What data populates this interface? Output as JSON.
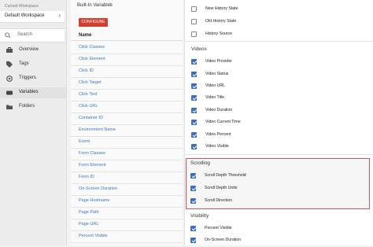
{
  "workspace": {
    "label": "Current Workspace",
    "name": "Default Workspace"
  },
  "search": {
    "placeholder": "Search"
  },
  "nav": [
    {
      "label": "Overview",
      "icon": "briefcase-icon"
    },
    {
      "label": "Tags",
      "icon": "tag-icon"
    },
    {
      "label": "Triggers",
      "icon": "trigger-icon"
    },
    {
      "label": "Variables",
      "icon": "variables-icon",
      "active": true
    },
    {
      "label": "Folders",
      "icon": "folder-icon"
    }
  ],
  "list": {
    "title": "Built-In Variables",
    "badge": "?",
    "configure_label": "CONFIGURE",
    "column_name": "Name",
    "items": [
      "Click Classes",
      "Click Element",
      "Click ID",
      "Click Target",
      "Click Text",
      "Click URL",
      "Container ID",
      "Environment Name",
      "Event",
      "Form Classes",
      "Form Element",
      "Form ID",
      "On-Screen Duration",
      "Page Hostname",
      "Page Path",
      "Page URL",
      "Percent Visible"
    ]
  },
  "panel": {
    "history": [
      {
        "label": "New History State",
        "checked": false
      },
      {
        "label": "Old History State",
        "checked": false
      },
      {
        "label": "History Source",
        "checked": false
      }
    ],
    "videos_title": "Videos",
    "videos": [
      {
        "label": "Video Provider",
        "checked": true
      },
      {
        "label": "Video Status",
        "checked": true
      },
      {
        "label": "Video URL",
        "checked": true
      },
      {
        "label": "Video Title",
        "checked": true
      },
      {
        "label": "Video Duration",
        "checked": true
      },
      {
        "label": "Video Current Time",
        "checked": true
      },
      {
        "label": "Video Percent",
        "checked": true
      },
      {
        "label": "Video Visible",
        "checked": true
      }
    ],
    "scrolling_title": "Scrolling",
    "scrolling": [
      {
        "label": "Scroll Depth Threshold",
        "checked": true
      },
      {
        "label": "Scroll Depth Units",
        "checked": true
      },
      {
        "label": "Scroll Direction",
        "checked": true
      }
    ],
    "visibility_title": "Visibility",
    "visibility": [
      {
        "label": "Percent Visible",
        "checked": true
      },
      {
        "label": "On-Screen Duration",
        "checked": true
      }
    ]
  },
  "colors": {
    "accent": "#d23f31",
    "link": "#3a77c3",
    "checkbox": "#3e6dc0",
    "highlight": "#d9534f"
  }
}
